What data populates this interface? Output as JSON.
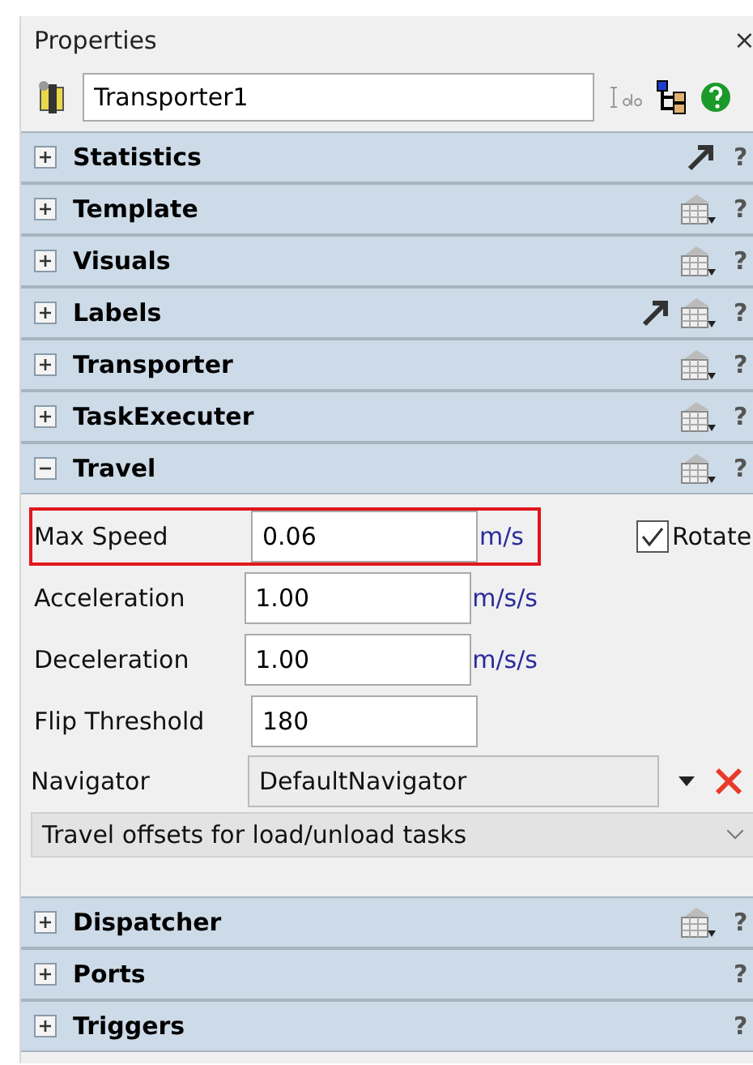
{
  "panel": {
    "title": "Properties",
    "close": "×"
  },
  "object": {
    "name": "Transporter1"
  },
  "sections": [
    {
      "title": "Statistics",
      "expanded": false,
      "has_link": true,
      "has_template": false,
      "help": "?"
    },
    {
      "title": "Template",
      "expanded": false,
      "has_link": false,
      "has_template": true,
      "help": "?"
    },
    {
      "title": "Visuals",
      "expanded": false,
      "has_link": false,
      "has_template": true,
      "help": "?"
    },
    {
      "title": "Labels",
      "expanded": false,
      "has_link": true,
      "has_template": true,
      "help": "?"
    },
    {
      "title": "Transporter",
      "expanded": false,
      "has_link": false,
      "has_template": true,
      "help": "?"
    },
    {
      "title": "TaskExecuter",
      "expanded": false,
      "has_link": false,
      "has_template": true,
      "help": "?"
    },
    {
      "title": "Travel",
      "expanded": true,
      "has_link": false,
      "has_template": true,
      "help": "?",
      "fields": [
        {
          "label": "Max Speed",
          "value": "0.06",
          "unit": "m/s",
          "highlighted": true
        },
        {
          "label": "Acceleration",
          "value": "1.00",
          "unit": "m/s/s",
          "highlighted": false
        },
        {
          "label": "Deceleration",
          "value": "1.00",
          "unit": "m/s/s",
          "highlighted": false
        },
        {
          "label": "Flip Threshold",
          "value": "180",
          "highlighted": false
        }
      ],
      "rotate": {
        "label": "Rotate",
        "checked": true
      },
      "navigator": {
        "label": "Navigator",
        "value": "DefaultNavigator"
      },
      "offsets": {
        "label": "Travel offsets for load/unload tasks"
      }
    },
    {
      "title": "Dispatcher",
      "expanded": false,
      "has_link": false,
      "has_template": true,
      "help": "?"
    },
    {
      "title": "Ports",
      "expanded": false,
      "has_link": false,
      "has_template": false,
      "help": "?"
    },
    {
      "title": "Triggers",
      "expanded": false,
      "has_link": false,
      "has_template": false,
      "help": "?"
    }
  ]
}
